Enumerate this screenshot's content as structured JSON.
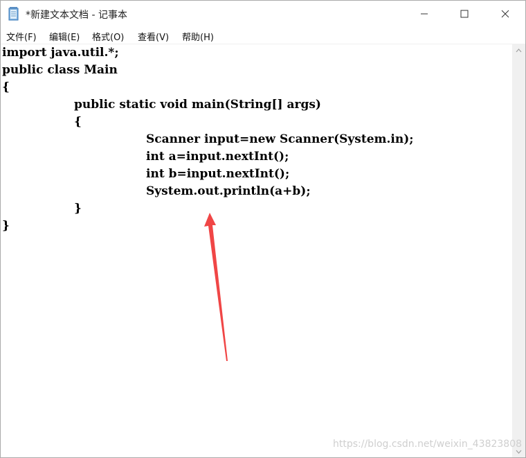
{
  "window": {
    "title": "*新建文本文档 - 记事本",
    "icon": "notepad-icon"
  },
  "menu": [
    {
      "label": "文件(F)"
    },
    {
      "label": "编辑(E)"
    },
    {
      "label": "格式(O)"
    },
    {
      "label": "查看(V)"
    },
    {
      "label": "帮助(H)"
    }
  ],
  "editor": {
    "lines": [
      "import java.util.*;",
      "public class Main",
      "{",
      "public static void main(String[] args)",
      "{",
      "Scanner input=new Scanner(System.in);",
      "int a=input.nextInt();",
      "int b=input.nextInt();",
      "System.out.println(a+b);",
      "}",
      "}"
    ]
  },
  "annotation": {
    "arrow_color": "#f04646"
  },
  "watermark": "https://blog.csdn.net/weixin_43823808"
}
